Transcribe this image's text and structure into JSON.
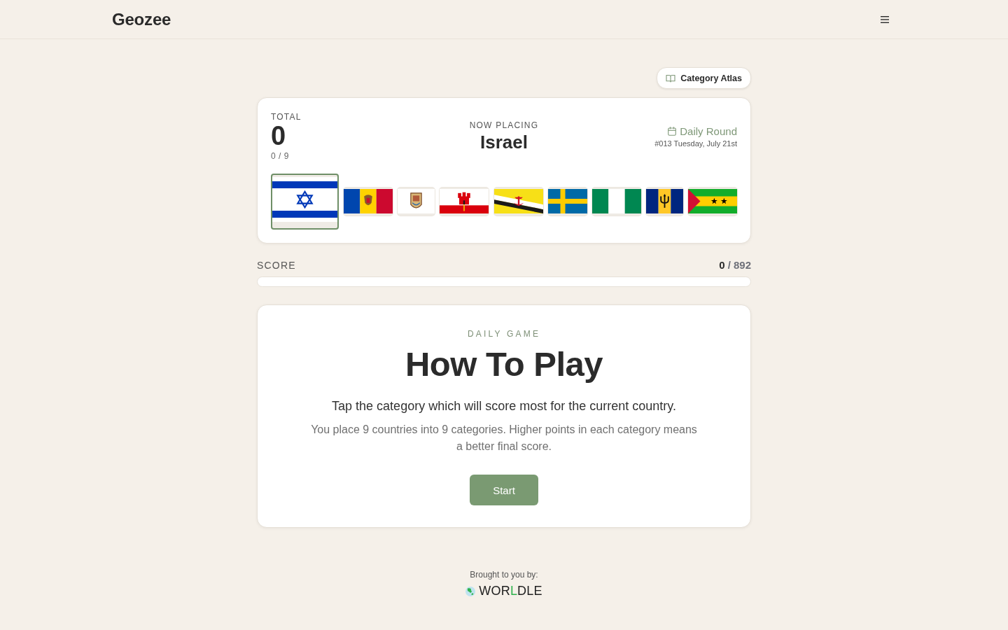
{
  "header": {
    "logo": "Geozee"
  },
  "atlas_button": {
    "label": "Category Atlas"
  },
  "round_card": {
    "total_label": "TOTAL",
    "total_value": "0",
    "placed_count": "0 / 9",
    "now_placing_label": "NOW PLACING",
    "country": "Israel",
    "round_title": "Daily Round",
    "round_date": "#013 Tuesday, July 21st",
    "flags": [
      {
        "kind": "israel",
        "selected": true
      },
      {
        "kind": "moldova",
        "selected": false
      },
      {
        "kind": "emblem",
        "selected": false
      },
      {
        "kind": "gibraltar",
        "selected": false
      },
      {
        "kind": "brunei",
        "selected": false
      },
      {
        "kind": "sweden",
        "selected": false
      },
      {
        "kind": "nigeria",
        "selected": false
      },
      {
        "kind": "barbados",
        "selected": false
      },
      {
        "kind": "saotome",
        "selected": false
      }
    ]
  },
  "score": {
    "label": "SCORE",
    "points": "0",
    "max": "/ 892"
  },
  "how_to_play": {
    "eyebrow": "DAILY GAME",
    "title": "How To Play",
    "lead": "Tap the category which will score most for the current country.",
    "body": "You place 9 countries into 9 categories. Higher points in each category means a better final score.",
    "start_button": "Start"
  },
  "footer": {
    "credit": "Brought to you by:",
    "brand_parts": [
      {
        "text": "WOR",
        "accent": false
      },
      {
        "text": "L",
        "accent": true
      },
      {
        "text": "DLE",
        "accent": false
      }
    ]
  }
}
